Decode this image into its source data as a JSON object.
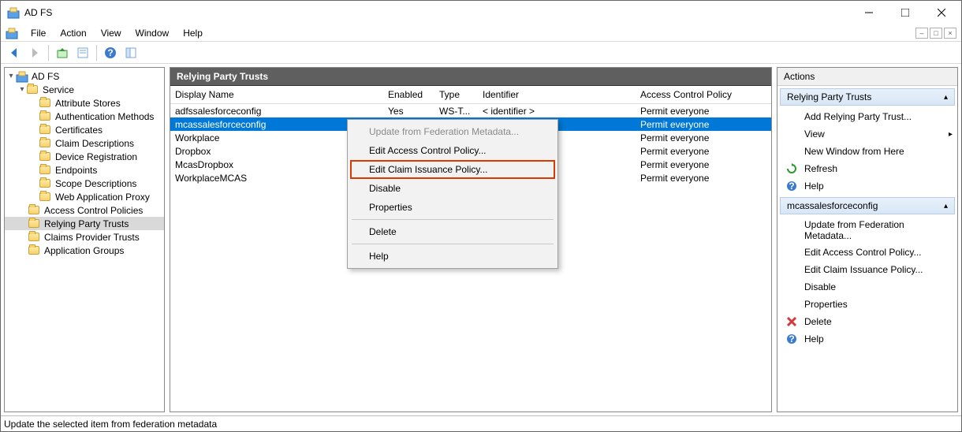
{
  "title": "AD FS",
  "menus": [
    "File",
    "Action",
    "View",
    "Window",
    "Help"
  ],
  "tree": {
    "root": "AD FS",
    "service": "Service",
    "service_children": [
      "Attribute Stores",
      "Authentication Methods",
      "Certificates",
      "Claim Descriptions",
      "Device Registration",
      "Endpoints",
      "Scope Descriptions",
      "Web Application Proxy"
    ],
    "siblings": [
      "Access Control Policies",
      "Relying Party Trusts",
      "Claims Provider Trusts",
      "Application Groups"
    ]
  },
  "center": {
    "title": "Relying Party Trusts",
    "columns": [
      "Display Name",
      "Enabled",
      "Type",
      "Identifier",
      "Access Control Policy"
    ],
    "rows": [
      {
        "name": "adfssalesforceconfig",
        "enabled": "Yes",
        "type": "WS-T...",
        "identifier": "< identifier >",
        "policy": "Permit everyone"
      },
      {
        "name": "mcassalesforceconfig",
        "enabled": "",
        "type": "",
        "identifier": "",
        "policy": "Permit everyone"
      },
      {
        "name": "Workplace",
        "enabled": "",
        "type": "",
        "identifier": "",
        "policy": "Permit everyone"
      },
      {
        "name": "Dropbox",
        "enabled": "",
        "type": "",
        "identifier": "",
        "policy": "Permit everyone"
      },
      {
        "name": "McasDropbox",
        "enabled": "",
        "type": "",
        "identifier": "",
        "policy": "Permit everyone"
      },
      {
        "name": "WorkplaceMCAS",
        "enabled": "",
        "type": "",
        "identifier": "",
        "policy": "Permit everyone"
      }
    ]
  },
  "context_menu": {
    "items": [
      {
        "label": "Update from Federation Metadata...",
        "disabled": true
      },
      {
        "label": "Edit Access Control Policy..."
      },
      {
        "label": "Edit Claim Issuance Policy...",
        "highlight": true
      },
      {
        "label": "Disable"
      },
      {
        "label": "Properties"
      },
      {
        "sep": true
      },
      {
        "label": "Delete"
      },
      {
        "sep": true
      },
      {
        "label": "Help"
      }
    ]
  },
  "actions": {
    "header": "Actions",
    "group1": {
      "title": "Relying Party Trusts",
      "items": [
        {
          "label": "Add Relying Party Trust..."
        },
        {
          "label": "View",
          "submenu": true
        },
        {
          "label": "New Window from Here"
        },
        {
          "label": "Refresh",
          "icon": "refresh"
        },
        {
          "label": "Help",
          "icon": "help"
        }
      ]
    },
    "group2": {
      "title": "mcassalesforceconfig",
      "items": [
        {
          "label": "Update from Federation Metadata..."
        },
        {
          "label": "Edit Access Control Policy..."
        },
        {
          "label": "Edit Claim Issuance Policy..."
        },
        {
          "label": "Disable"
        },
        {
          "label": "Properties"
        },
        {
          "label": "Delete",
          "icon": "delete"
        },
        {
          "label": "Help",
          "icon": "help"
        }
      ]
    }
  },
  "statusbar": "Update the selected item from federation metadata"
}
